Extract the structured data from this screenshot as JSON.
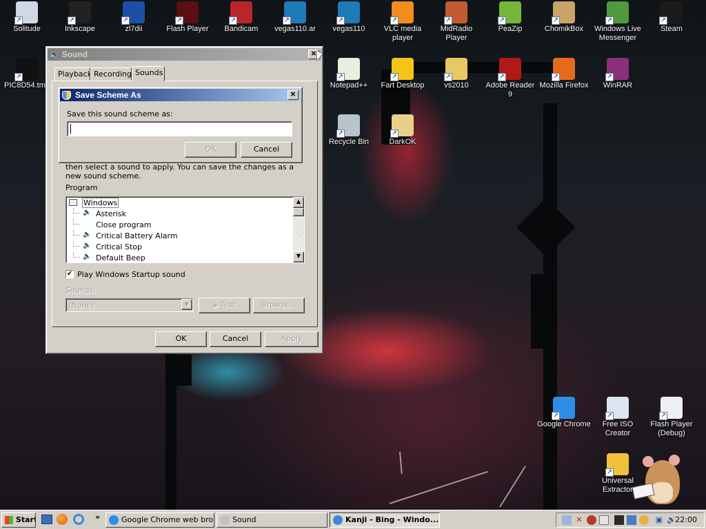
{
  "desktop_icons": [
    {
      "label": "Solitude",
      "icon": "solitude-icon",
      "color": "#cfd8e4"
    },
    {
      "label": "Inkscape",
      "icon": "inkscape-icon",
      "color": "#222222"
    },
    {
      "label": "zl7dii",
      "icon": "shield-icon",
      "color": "#1e4fa8"
    },
    {
      "label": "Flash Player",
      "icon": "flash-icon",
      "color": "#5a0f12"
    },
    {
      "label": "Bandicam",
      "icon": "bandicam-icon",
      "color": "#b8262a"
    },
    {
      "label": "vegas110.ar",
      "icon": "disc-icon",
      "color": "#1f7ab8"
    },
    {
      "label": "vegas110",
      "icon": "disc-icon",
      "color": "#1f7ab8"
    },
    {
      "label": "VLC media player",
      "icon": "vlc-cone-icon",
      "color": "#f28c1b"
    },
    {
      "label": "MidRadio Player",
      "icon": "radio-icon",
      "color": "#c25b30"
    },
    {
      "label": "PeaZip",
      "icon": "peazip-icon",
      "color": "#74b83a"
    },
    {
      "label": "ChomikBox",
      "icon": "chomik-icon",
      "color": "#c9a36a"
    },
    {
      "label": "Windows Live Messenger",
      "icon": "messenger-icon",
      "color": "#4f9a3c"
    },
    {
      "label": "Steam",
      "icon": "steam-icon",
      "color": "#1b1b1b"
    },
    {
      "label": "PIC8D54.tmp",
      "icon": "image-file-icon",
      "color": "#111111"
    },
    {
      "label": "Notepad++",
      "icon": "notepad-icon",
      "color": "#e8efe0"
    },
    {
      "label": "Fart Desktop",
      "icon": "smiley-icon",
      "color": "#f4c518"
    },
    {
      "label": "vs2010",
      "icon": "folder-icon",
      "color": "#e8c862"
    },
    {
      "label": "Adobe Reader 9",
      "icon": "pdf-icon",
      "color": "#b11818"
    },
    {
      "label": "Mozilla Firefox",
      "icon": "firefox-icon",
      "color": "#e66a1e"
    },
    {
      "label": "WinRAR",
      "icon": "winrar-icon",
      "color": "#8a2f7a"
    },
    {
      "label": "Recycle Bin",
      "icon": "recycle-bin-icon",
      "color": "#b9c3cc"
    },
    {
      "label": "DarkOK",
      "icon": "zip-folder-icon",
      "color": "#e8d08a"
    },
    {
      "label": "Google Chrome",
      "icon": "chrome-icon",
      "color": "#2e8ee6"
    },
    {
      "label": "Free ISO Creator",
      "icon": "iso-icon",
      "color": "#dce4ee"
    },
    {
      "label": "Flash Player (Debug)",
      "icon": "file-icon",
      "color": "#eef0f2"
    },
    {
      "label": "Universal Extractor",
      "icon": "extractor-icon",
      "color": "#f0c23a"
    },
    {
      "label": "4)",
      "icon": "",
      "color": ""
    }
  ],
  "sound_window": {
    "title": "Sound",
    "tabs": [
      "Playback",
      "Recording",
      "Sounds"
    ],
    "selected_tab": "Sounds",
    "partial_description": "then select a sound to apply. You can save the changes as a new sound scheme.",
    "program_label": "Program",
    "events": [
      {
        "label": "Windows",
        "kind": "group"
      },
      {
        "label": "Asterisk",
        "kind": "sound"
      },
      {
        "label": "Close program",
        "kind": "none"
      },
      {
        "label": "Critical Battery Alarm",
        "kind": "sound"
      },
      {
        "label": "Critical Stop",
        "kind": "sound"
      },
      {
        "label": "Default Beep",
        "kind": "sound"
      }
    ],
    "startup_checkbox": {
      "label": "Play Windows Startup sound",
      "checked": true
    },
    "sounds_label": "Sounds:",
    "sounds_select_value": "(None)",
    "test_label": "Test",
    "browse_label": "Browse...",
    "ok_label": "OK",
    "cancel_label": "Cancel",
    "apply_label": "Apply"
  },
  "save_scheme_dialog": {
    "title": "Save Scheme As",
    "prompt": "Save this sound scheme as:",
    "input_value": "",
    "ok_label": "OK",
    "cancel_label": "Cancel"
  },
  "taskbar": {
    "start_label": "Start",
    "more_label": "»",
    "tasks": [
      {
        "label": "Google Chrome web brow...",
        "active": false,
        "color": "#2e8ee6"
      },
      {
        "label": "Sound",
        "active": false,
        "color": "#c0c0c0"
      },
      {
        "label": "Kanji - Bing - Windo...",
        "active": true,
        "color": "#3b8ad8"
      }
    ],
    "clock": "22:00"
  },
  "colors": {
    "active_title": "#0a246a",
    "inactive_title": "#808080",
    "face": "#d4d0c8"
  }
}
